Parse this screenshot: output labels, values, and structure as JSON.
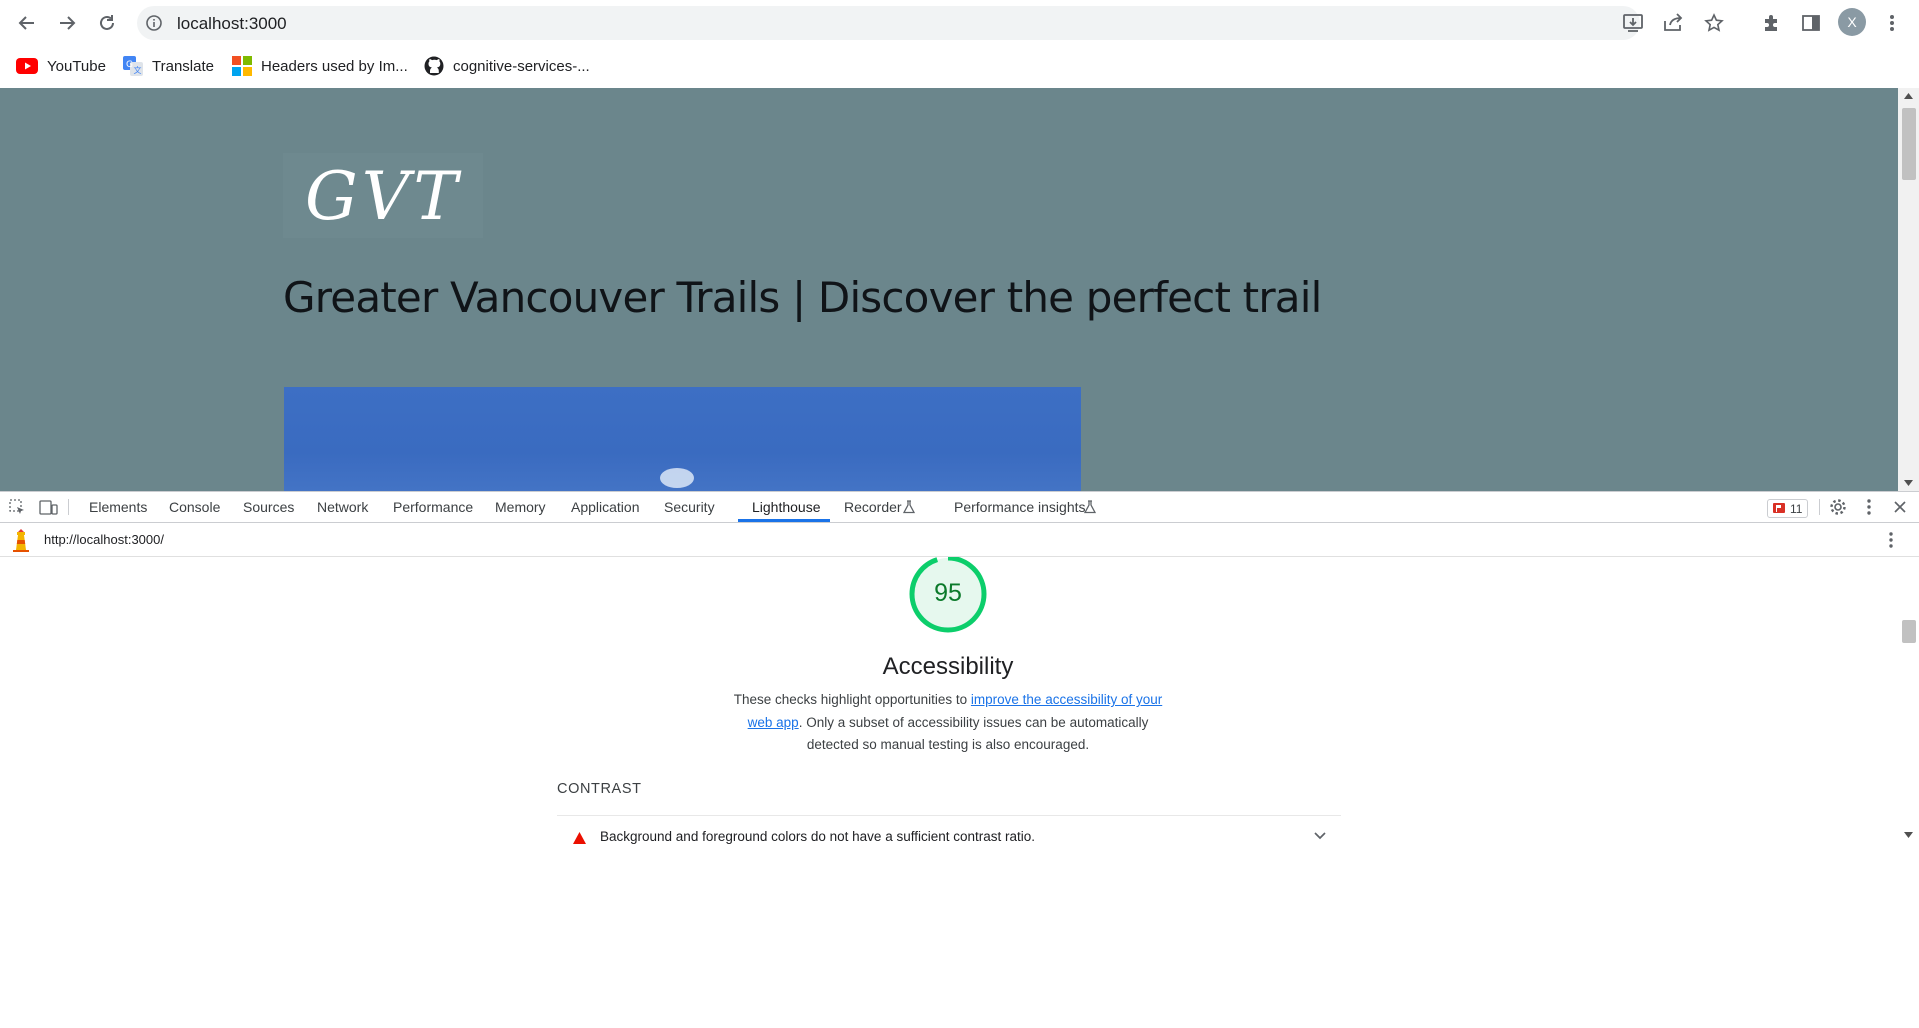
{
  "browser": {
    "address": "localhost:3000",
    "avatar_letter": "X",
    "bookmarks": [
      {
        "label": "YouTube",
        "icon": "youtube-icon"
      },
      {
        "label": "Translate",
        "icon": "google-translate-icon"
      },
      {
        "label": "Headers used by Im...",
        "icon": "microsoft-icon"
      },
      {
        "label": "cognitive-services-...",
        "icon": "github-icon"
      }
    ]
  },
  "page": {
    "logo": "GVT",
    "heading": "Greater Vancouver Trails | Discover the perfect trail"
  },
  "devtools": {
    "tabs": [
      "Elements",
      "Console",
      "Sources",
      "Network",
      "Performance",
      "Memory",
      "Application",
      "Security",
      "Lighthouse",
      "Recorder",
      "Performance insights"
    ],
    "active_tab": "Lighthouse",
    "issues_count": "11",
    "lighthouse": {
      "report_url": "http://localhost:3000/",
      "score": "95",
      "category_title": "Accessibility",
      "description_before": "These checks highlight opportunities to ",
      "description_link": "improve the accessibility of your web app",
      "description_after": ". Only a subset of accessibility issues can be automatically detected so manual testing is also encouraged.",
      "group_title": "CONTRAST",
      "audit_title": "Background and foreground colors do not have a sufficient contrast ratio."
    }
  },
  "colors": {
    "page_background": "#6b868c",
    "score_pass": "#0cce6b",
    "score_text": "#0c7a2b",
    "link": "#1a73e8",
    "audit_fail": "#eb0f00",
    "tab_underline": "#1a73e8"
  },
  "score_value": 95
}
